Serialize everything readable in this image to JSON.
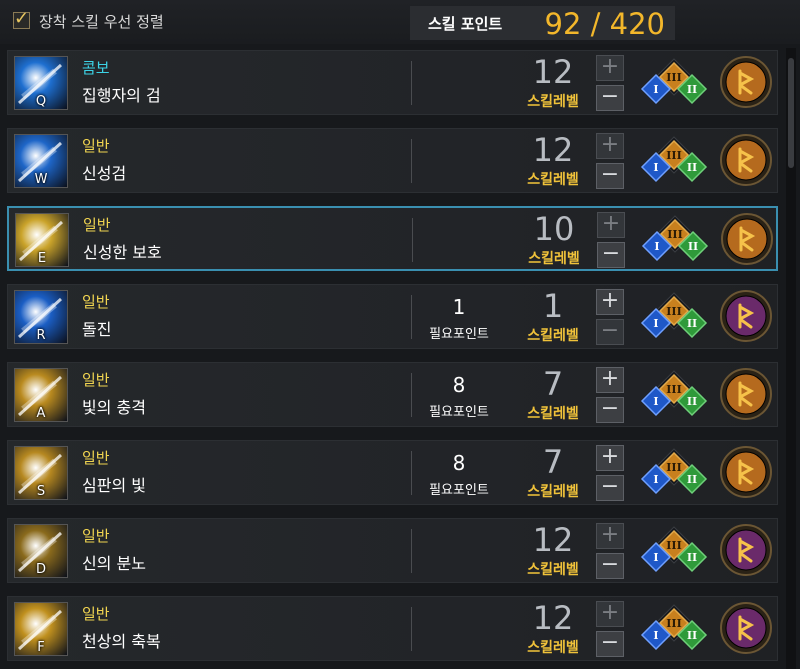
{
  "header": {
    "sort_checkbox_checked": true,
    "sort_label": "장착 스킬 우선 정렬",
    "skill_points_label": "스킬 포인트",
    "skill_points_value": "92 / 420"
  },
  "level_label": "스킬레벨",
  "required_label": "필요포인트",
  "rows": [
    {
      "hotkey": "Q",
      "category": "콤보",
      "category_type": "combo",
      "name": "집행자의 검",
      "required": "",
      "level": "12",
      "plus_active": false,
      "minus_active": true,
      "rune": "orange",
      "icon_color": "#1e6fd0"
    },
    {
      "hotkey": "W",
      "category": "일반",
      "category_type": "normal",
      "name": "신성검",
      "required": "",
      "level": "12",
      "plus_active": false,
      "minus_active": true,
      "rune": "orange",
      "icon_color": "#1e66c8"
    },
    {
      "hotkey": "E",
      "category": "일반",
      "category_type": "normal",
      "name": "신성한 보호",
      "required": "",
      "level": "10",
      "plus_active": false,
      "minus_active": true,
      "rune": "orange",
      "icon_color": "#caa32a",
      "selected": true
    },
    {
      "hotkey": "R",
      "category": "일반",
      "category_type": "normal",
      "name": "돌진",
      "required": "1",
      "level": "1",
      "plus_active": true,
      "minus_active": false,
      "rune": "purple",
      "icon_color": "#1b5ec4"
    },
    {
      "hotkey": "A",
      "category": "일반",
      "category_type": "normal",
      "name": "빛의 충격",
      "required": "8",
      "level": "7",
      "plus_active": true,
      "minus_active": true,
      "rune": "orange",
      "icon_color": "#b98a1f"
    },
    {
      "hotkey": "S",
      "category": "일반",
      "category_type": "normal",
      "name": "심판의 빛",
      "required": "8",
      "level": "7",
      "plus_active": true,
      "minus_active": true,
      "rune": "orange",
      "icon_color": "#b68820"
    },
    {
      "hotkey": "D",
      "category": "일반",
      "category_type": "normal",
      "name": "신의 분노",
      "required": "",
      "level": "12",
      "plus_active": false,
      "minus_active": true,
      "rune": "purple",
      "icon_color": "#8a6a1c"
    },
    {
      "hotkey": "F",
      "category": "일반",
      "category_type": "normal",
      "name": "천상의 축복",
      "required": "",
      "level": "12",
      "plus_active": false,
      "minus_active": true,
      "rune": "purple",
      "icon_color": "#c0901e"
    }
  ],
  "gem_labels": [
    "III",
    "I",
    "II"
  ],
  "colors": {
    "accent_gold": "#f3b72b",
    "combo_cyan": "#3cd3e6",
    "normal_yellow": "#f0d450",
    "selected_border": "#3a8fb0",
    "gem_orange": "#c8801e",
    "gem_blue": "#1f58c8",
    "gem_green": "#2f9a3a",
    "rune_orange": "#b56a1e",
    "rune_purple": "#6a2a6a"
  }
}
